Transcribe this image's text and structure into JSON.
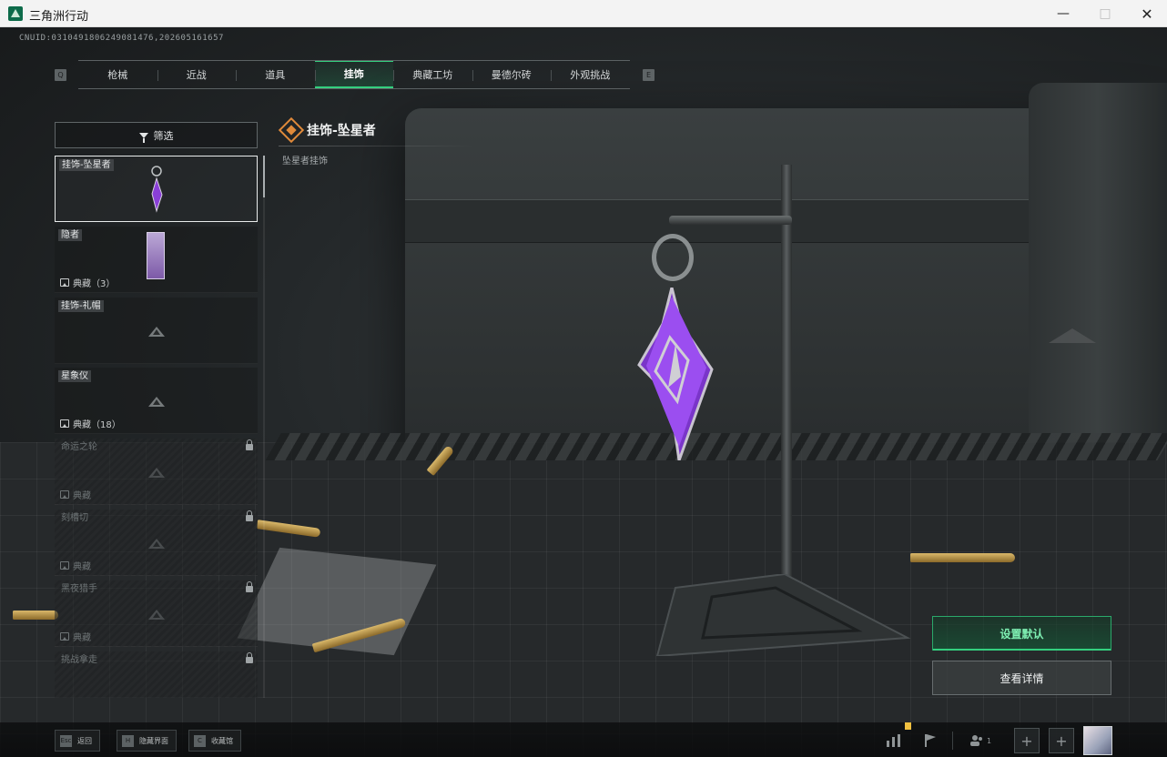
{
  "window": {
    "title": "三角洲行动"
  },
  "uid_text": "CNUID:0310491806249081476,202605161657",
  "tabs": [
    {
      "label": "枪械",
      "active": false
    },
    {
      "label": "近战",
      "active": false
    },
    {
      "label": "道具",
      "active": false
    },
    {
      "label": "挂饰",
      "active": true
    },
    {
      "label": "典藏工坊",
      "active": false
    },
    {
      "label": "曼德尔砖",
      "active": false
    },
    {
      "label": "外观挑战",
      "active": false
    }
  ],
  "tab_keys": {
    "left": "Q",
    "right": "E"
  },
  "filter": {
    "label": "筛选"
  },
  "items": [
    {
      "name": "挂饰-坠星者",
      "selected": true,
      "locked": false,
      "count": ""
    },
    {
      "name": "隐者",
      "selected": false,
      "locked": false,
      "count": "典藏（3）"
    },
    {
      "name": "挂饰-礼帽",
      "selected": false,
      "locked": false,
      "count": ""
    },
    {
      "name": "星象仪",
      "selected": false,
      "locked": false,
      "count": "典藏（18）"
    },
    {
      "name": "命运之轮",
      "selected": false,
      "locked": true,
      "count": "典藏"
    },
    {
      "name": "刻槽切",
      "selected": false,
      "locked": true,
      "count": "典藏"
    },
    {
      "name": "黑夜猎手",
      "selected": false,
      "locked": true,
      "count": "典藏"
    },
    {
      "name": "挑战拿走",
      "selected": false,
      "locked": true,
      "count": ""
    }
  ],
  "detail": {
    "title": "挂饰-坠星者",
    "subtitle": "坠星者挂饰"
  },
  "actions": {
    "set_default": "设置默认",
    "view_details": "查看详情"
  },
  "bottom_hints": [
    {
      "key": "Esc",
      "label": "返回"
    },
    {
      "key": "H",
      "label": "隐藏界面"
    },
    {
      "key": "C",
      "label": "收藏馆"
    }
  ],
  "bottom_right": {
    "friends_count": "1",
    "icons": [
      "stats-icon",
      "flag-icon",
      "friends-icon"
    ]
  },
  "colors": {
    "accent": "#34d07f",
    "gem": "#8a3fd8",
    "title_icon": "#e08a3a"
  }
}
